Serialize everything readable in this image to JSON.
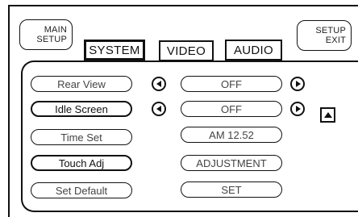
{
  "header": {
    "main_setup": {
      "line1": "MAIN",
      "line2": "SETUP"
    },
    "setup_exit": {
      "line1": "SETUP",
      "line2": "EXIT"
    }
  },
  "tabs": [
    {
      "label": "SYSTEM",
      "selected": true
    },
    {
      "label": "VIDEO",
      "selected": false
    },
    {
      "label": "AUDIO",
      "selected": false
    }
  ],
  "settings": [
    {
      "label": "Rear View",
      "value": "OFF",
      "has_arrows": true
    },
    {
      "label": "Idle Screen",
      "value": "OFF",
      "has_arrows": true
    },
    {
      "label": "Time Set",
      "value": "AM 12.52",
      "has_arrows": false
    },
    {
      "label": "Touch Adj",
      "value": "ADJUSTMENT",
      "has_arrows": false
    },
    {
      "label": "Set Default",
      "value": "SET",
      "has_arrows": false
    }
  ],
  "icons": {
    "left_arrow": "arrow-left-icon",
    "right_arrow": "arrow-right-icon",
    "scroll_up": "arrow-up-icon"
  },
  "colors": {
    "foreground": "#111111",
    "background": "#ffffff"
  }
}
